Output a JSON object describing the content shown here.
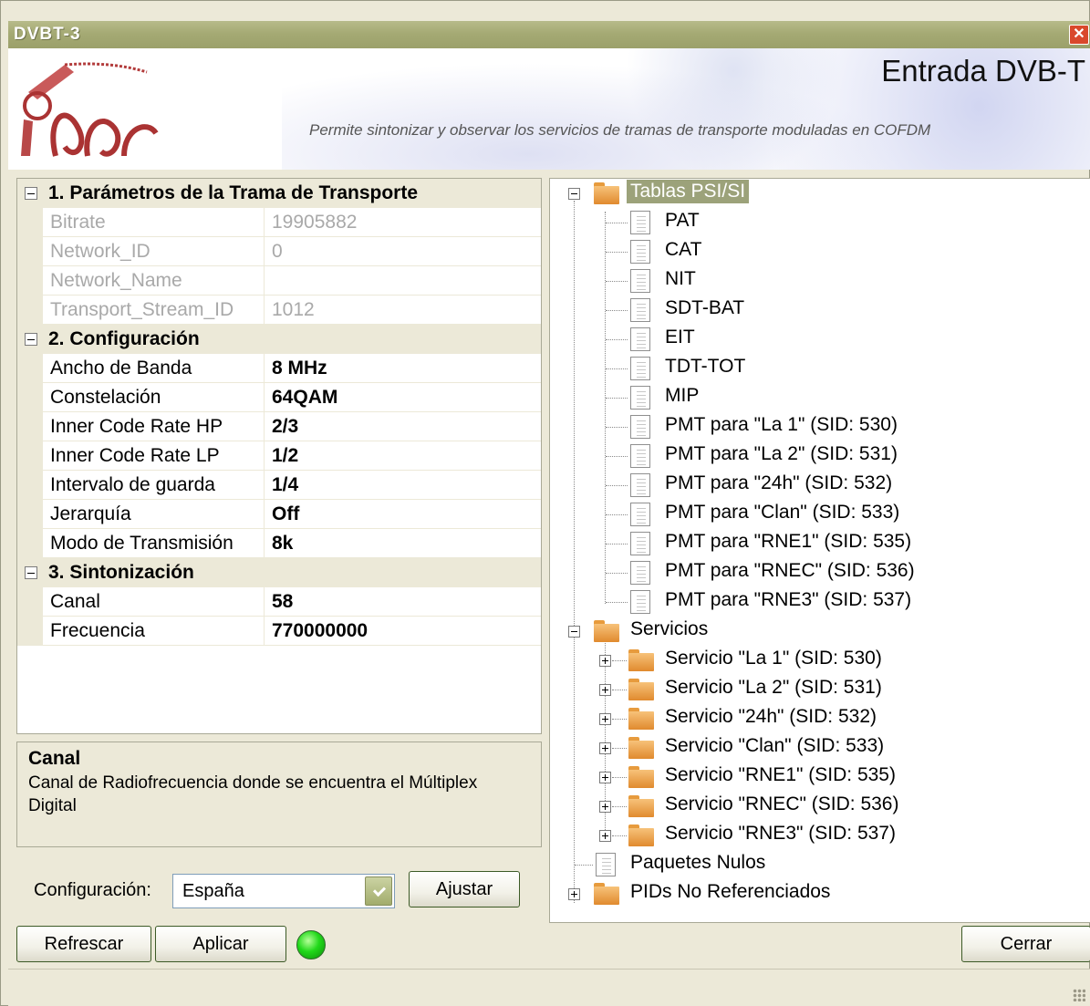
{
  "window": {
    "title": "DVBT-3"
  },
  "header": {
    "title": "Entrada DVB-T",
    "subtitle": "Permite sintonizar y observar los servicios de tramas de transporte moduladas en COFDM"
  },
  "properties": {
    "section1": {
      "label": "1. Parámetros de la Trama de Transporte",
      "rows": [
        {
          "name": "Bitrate",
          "value": "19905882"
        },
        {
          "name": "Network_ID",
          "value": "0"
        },
        {
          "name": "Network_Name",
          "value": ""
        },
        {
          "name": "Transport_Stream_ID",
          "value": "1012"
        }
      ]
    },
    "section2": {
      "label": "2. Configuración",
      "rows": [
        {
          "name": "Ancho de Banda",
          "value": "8 MHz"
        },
        {
          "name": "Constelación",
          "value": "64QAM"
        },
        {
          "name": "Inner Code Rate HP",
          "value": "2/3"
        },
        {
          "name": "Inner Code Rate LP",
          "value": "1/2"
        },
        {
          "name": "Intervalo de guarda",
          "value": "1/4"
        },
        {
          "name": "Jerarquía",
          "value": "Off"
        },
        {
          "name": "Modo de Transmisión",
          "value": "8k"
        }
      ]
    },
    "section3": {
      "label": "3. Sintonización",
      "rows": [
        {
          "name": "Canal",
          "value": "58"
        },
        {
          "name": "Frecuencia",
          "value": "770000000"
        }
      ]
    }
  },
  "description": {
    "title": "Canal",
    "text": "Canal de Radiofrecuencia donde se encuentra el Múltiplex Digital"
  },
  "config": {
    "label": "Configuración:",
    "selected": "España",
    "adjust_label": "Ajustar"
  },
  "buttons": {
    "refresh": "Refrescar",
    "apply": "Aplicar",
    "close": "Cerrar"
  },
  "status": {
    "led_color": "#21d91a"
  },
  "tree": {
    "tables": {
      "label": "Tablas PSI/SI",
      "children": [
        "PAT",
        "CAT",
        "NIT",
        "SDT-BAT",
        "EIT",
        "TDT-TOT",
        "MIP",
        "PMT para \"La 1\" (SID: 530)",
        "PMT para \"La 2\" (SID: 531)",
        "PMT para \"24h\" (SID: 532)",
        "PMT para \"Clan\" (SID: 533)",
        "PMT para \"RNE1\" (SID: 535)",
        "PMT para \"RNEC\" (SID: 536)",
        "PMT para \"RNE3\" (SID: 537)"
      ]
    },
    "services": {
      "label": "Servicios",
      "children": [
        "Servicio \"La 1\" (SID: 530)",
        "Servicio \"La 2\" (SID: 531)",
        "Servicio \"24h\" (SID: 532)",
        "Servicio \"Clan\" (SID: 533)",
        "Servicio \"RNE1\" (SID: 535)",
        "Servicio \"RNEC\" (SID: 536)",
        "Servicio \"RNE3\" (SID: 537)"
      ]
    },
    "null_packets": "Paquetes Nulos",
    "unreferenced": "PIDs No Referenciados"
  }
}
